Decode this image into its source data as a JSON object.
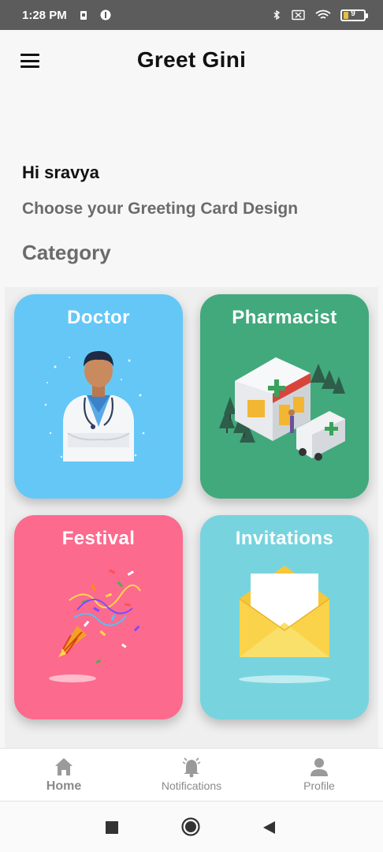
{
  "status_bar": {
    "time": "1:28 PM",
    "battery_level": "9"
  },
  "app_bar": {
    "title": "Greet Gini",
    "menu_icon": "hamburger-menu-icon"
  },
  "greeting": "Hi  sravya",
  "subtitle": "Choose your Greeting Card Design",
  "section_title": "Category",
  "categories": [
    {
      "label": "Doctor",
      "color": "#65c7f6",
      "illustration": "doctor-illustration"
    },
    {
      "label": "Pharmacist",
      "color": "#42a97d",
      "illustration": "pharmacy-illustration"
    },
    {
      "label": "Festival",
      "color": "#fc6a8e",
      "illustration": "party-popper-illustration"
    },
    {
      "label": "Invitations",
      "color": "#77d4df",
      "illustration": "envelope-illustration"
    }
  ],
  "bottom_nav": {
    "items": [
      {
        "label": "Home",
        "icon": "home-icon",
        "active": true
      },
      {
        "label": "Notifications",
        "icon": "bell-icon",
        "active": false
      },
      {
        "label": "Profile",
        "icon": "person-icon",
        "active": false
      }
    ]
  },
  "system_nav": {
    "recents_icon": "square-icon",
    "home_icon": "circle-icon",
    "back_icon": "triangle-back-icon"
  }
}
